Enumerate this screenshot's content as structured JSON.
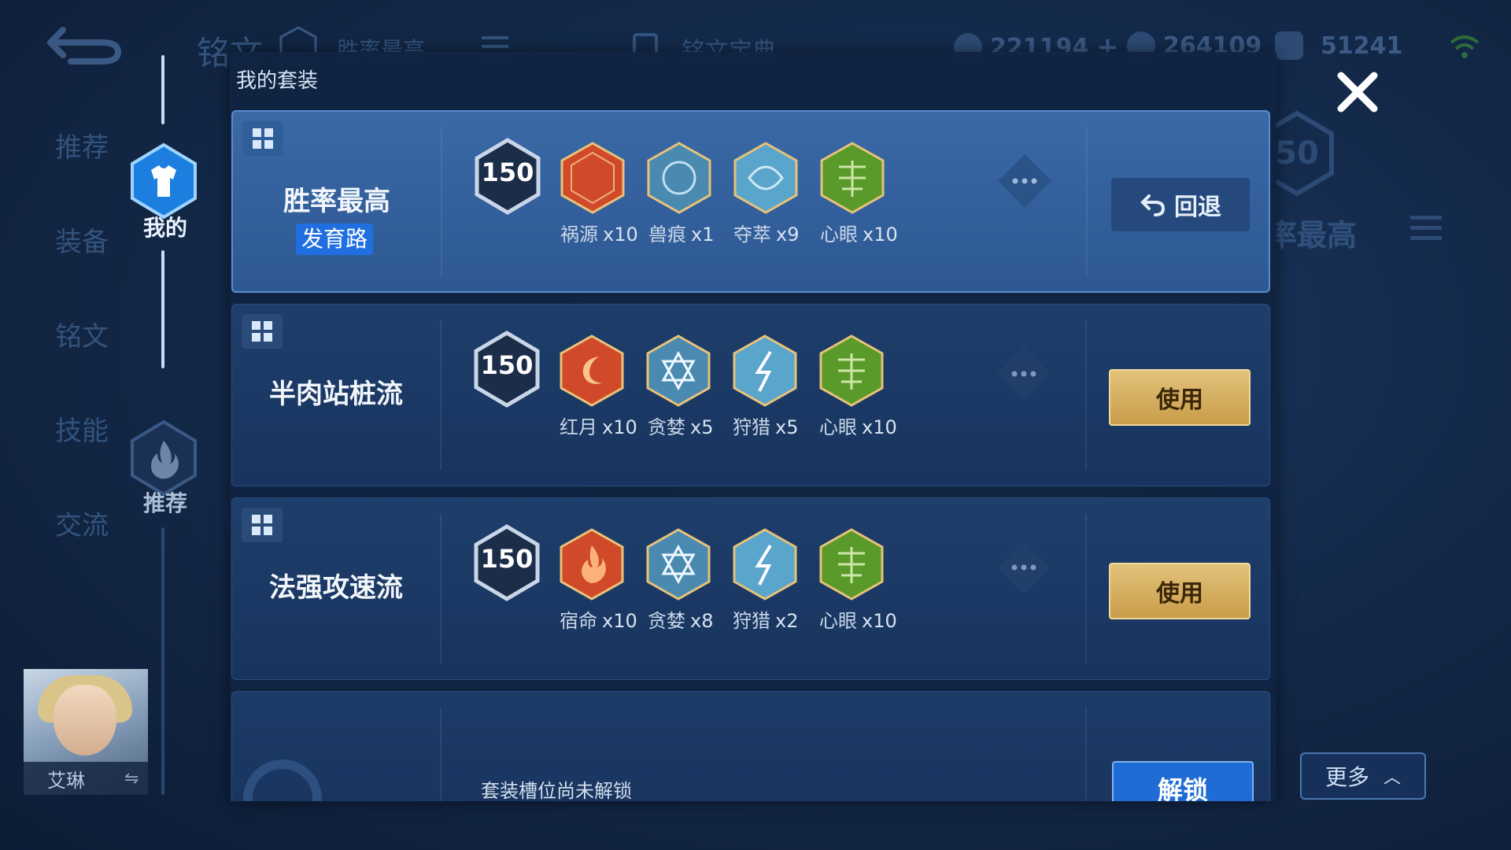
{
  "background": {
    "page_title": "铭文",
    "level_badge": "150",
    "current_set": "胜率最高",
    "book_label": "铭文宝典",
    "resources": [
      {
        "name": "diamond",
        "value": "221194"
      },
      {
        "name": "gold",
        "value": "264109"
      },
      {
        "name": "gem",
        "value": "51241"
      }
    ],
    "nav_items": [
      "推荐",
      "装备",
      "铭文",
      "技能",
      "交流"
    ],
    "right_ghost_text": "率最高",
    "right_ghost_badge": "50"
  },
  "sidebar": {
    "mine_label": "我的",
    "recommend_label": "推荐",
    "hero_name": "艾琳"
  },
  "modal": {
    "title": "我的套装",
    "cards": [
      {
        "name": "胜率最高",
        "tag": "发育路",
        "level": "150",
        "active": true,
        "action": "回退",
        "runes": [
          {
            "name": "祸源",
            "count": "x10",
            "color": "#d04a2a",
            "icon": "red-rune-icon"
          },
          {
            "name": "兽痕",
            "count": "x1",
            "color": "#4a8ab0",
            "icon": "blue-rune-icon"
          },
          {
            "name": "夺萃",
            "count": "x9",
            "color": "#5aa5cc",
            "icon": "blue-rune-icon"
          },
          {
            "name": "心眼",
            "count": "x10",
            "color": "#5a9a2a",
            "icon": "green-rune-icon"
          }
        ]
      },
      {
        "name": "半肉站桩流",
        "level": "150",
        "active": false,
        "action": "使用",
        "runes": [
          {
            "name": "红月",
            "count": "x10",
            "color": "#d04a2a",
            "icon": "red-rune-icon"
          },
          {
            "name": "贪婪",
            "count": "x5",
            "color": "#4a8ab0",
            "icon": "blue-rune-icon"
          },
          {
            "name": "狩猎",
            "count": "x5",
            "color": "#5aa5cc",
            "icon": "blue-rune-icon"
          },
          {
            "name": "心眼",
            "count": "x10",
            "color": "#5a9a2a",
            "icon": "green-rune-icon"
          }
        ]
      },
      {
        "name": "法强攻速流",
        "level": "150",
        "active": false,
        "action": "使用",
        "runes": [
          {
            "name": "宿命",
            "count": "x10",
            "color": "#d04a2a",
            "icon": "red-rune-icon"
          },
          {
            "name": "贪婪",
            "count": "x8",
            "color": "#4a8ab0",
            "icon": "blue-rune-icon"
          },
          {
            "name": "狩猎",
            "count": "x2",
            "color": "#5aa5cc",
            "icon": "blue-rune-icon"
          },
          {
            "name": "心眼",
            "count": "x10",
            "color": "#5a9a2a",
            "icon": "green-rune-icon"
          }
        ]
      }
    ],
    "locked_message": "套装槽位尚未解锁",
    "unlock_label": "解锁"
  },
  "more_label": "更多"
}
